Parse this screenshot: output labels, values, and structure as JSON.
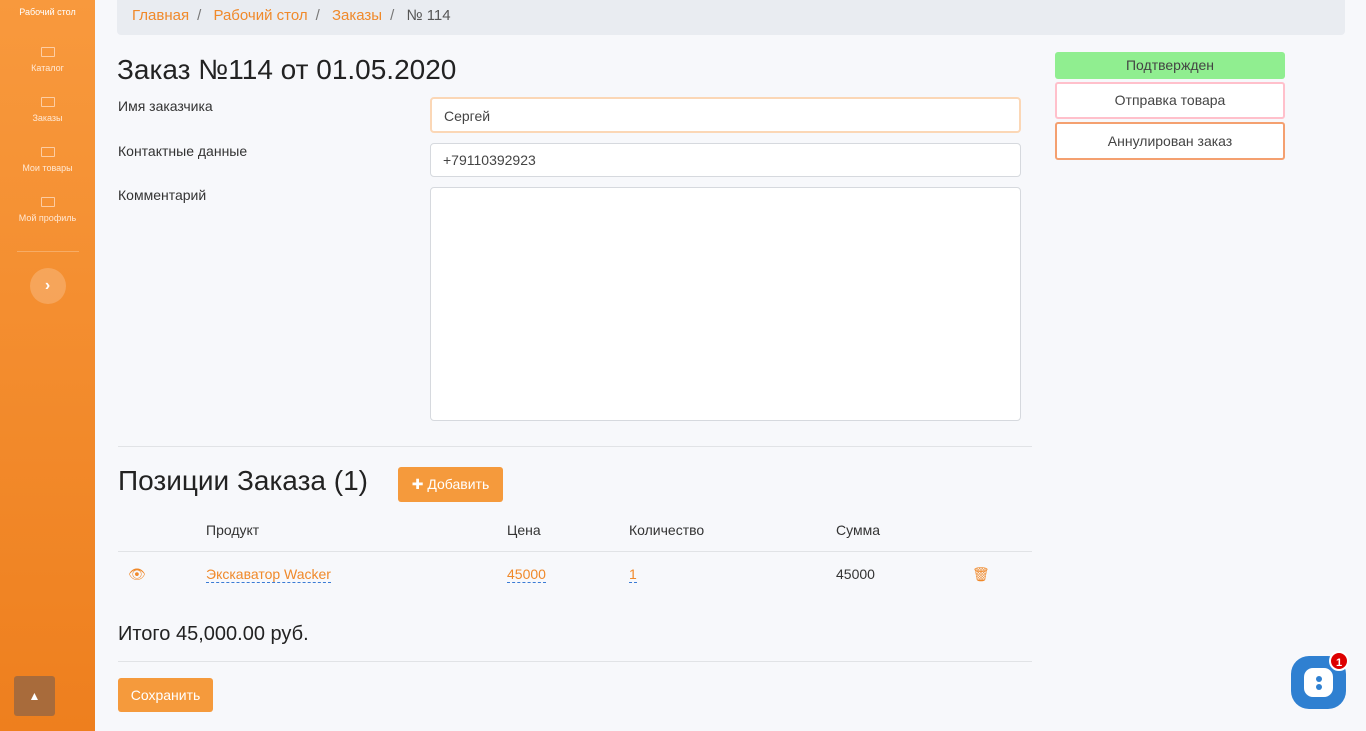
{
  "sidebar": {
    "top": "Рабочий стол",
    "items": [
      {
        "label": "Каталог"
      },
      {
        "label": "Заказы"
      },
      {
        "label": "Мои товары"
      },
      {
        "label": "Мой профиль"
      }
    ]
  },
  "breadcrumb": [
    "Главная",
    "Рабочий стол",
    "Заказы",
    "№ 114"
  ],
  "title": "Заказ №114 от 01.05.2020",
  "form": {
    "name_label": "Имя заказчика",
    "name_value": "Сергей",
    "contact_label": "Контактные данные",
    "contact_value": "+79110392923",
    "comment_label": "Комментарий",
    "comment_value": ""
  },
  "statuses": [
    {
      "label": "Подтвержден",
      "bg": "#90ee90",
      "border": "#90ee90"
    },
    {
      "label": "Отправка товара",
      "bg": "#ffffff",
      "border": "#ffc0cb"
    },
    {
      "label": "Аннулирован заказ",
      "bg": "#ffffff",
      "border": "#f4a070"
    }
  ],
  "positions": {
    "title": "Позиции Заказа (1)",
    "add_label": "Добавить",
    "headers": [
      "Продукт",
      "Цена",
      "Количество",
      "Сумма"
    ],
    "rows": [
      {
        "product": "Экскаватор Wacker",
        "price": "45000",
        "qty": "1",
        "sum": "45000"
      }
    ]
  },
  "total": "Итого 45,000.00 руб.",
  "save_label": "Сохранить",
  "chat": {
    "badge": "1"
  }
}
